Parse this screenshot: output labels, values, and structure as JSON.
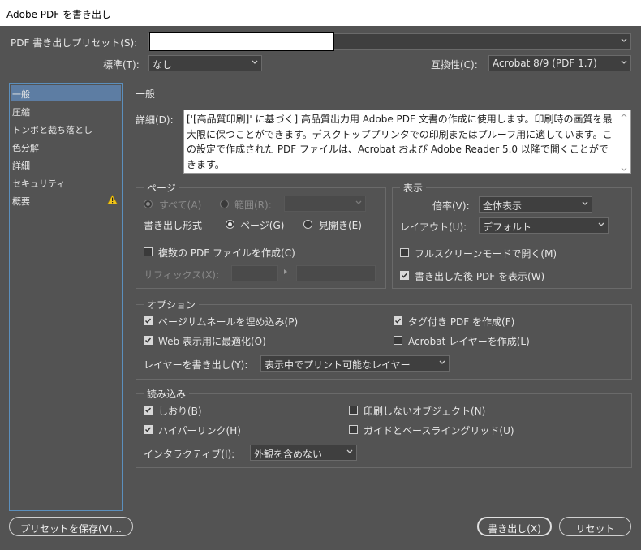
{
  "window": {
    "title": "Adobe PDF を書き出し"
  },
  "preset": {
    "label": "PDF 書き出しプリセット(S):"
  },
  "standard": {
    "label": "標準(T):",
    "value": "なし"
  },
  "compat": {
    "label": "互換性(C):",
    "value": "Acrobat 8/9 (PDF 1.7)"
  },
  "sidebar": {
    "items": [
      {
        "label": "一般"
      },
      {
        "label": "圧縮"
      },
      {
        "label": "トンボと裁ち落とし"
      },
      {
        "label": "色分解"
      },
      {
        "label": "詳細"
      },
      {
        "label": "セキュリティ"
      },
      {
        "label": "概要"
      }
    ],
    "selected_index": 0
  },
  "general": {
    "heading": "一般",
    "desc_label": "詳細(D):",
    "description": "['[高品質印刷]' に基づく] 高品質出力用 Adobe PDF 文書の作成に使用します。印刷時の画質を最大限に保つことができます。デスクトッププリンタでの印刷またはプルーフ用に適しています。この設定で作成された PDF ファイルは、Acrobat および Adobe Reader 5.0 以降で開くことができます。"
  },
  "pages": {
    "legend": "ページ",
    "all": "すべて(A)",
    "range": "範囲(R):",
    "export_as": "書き出し形式",
    "page": "ページ(G)",
    "spreads": "見開き(E)",
    "multi_pdf": "複数の PDF ファイルを作成(C)",
    "suffix": "サフィックス(X):"
  },
  "view": {
    "legend": "表示",
    "zoom_label": "倍率(V):",
    "zoom_value": "全体表示",
    "layout_label": "レイアウト(U):",
    "layout_value": "デフォルト",
    "fullscreen": "フルスクリーンモードで開く(M)",
    "view_after": "書き出した後 PDF を表示(W)"
  },
  "options": {
    "legend": "オプション",
    "thumbs": "ページサムネールを埋め込み(P)",
    "web": "Web 表示用に最適化(O)",
    "tagged": "タグ付き PDF を作成(F)",
    "acro_layers": "Acrobat レイヤーを作成(L)",
    "export_layers_label": "レイヤーを書き出し(Y):",
    "export_layers_value": "表示中でプリント可能なレイヤー"
  },
  "include": {
    "legend": "読み込み",
    "bookmarks": "しおり(B)",
    "hyperlinks": "ハイパーリンク(H)",
    "nonprint": "印刷しないオブジェクト(N)",
    "guides": "ガイドとベースライングリッド(U)",
    "interactive_label": "インタラクティブ(I):",
    "interactive_value": "外観を含めない"
  },
  "footer": {
    "save_preset": "プリセットを保存(V)...",
    "export": "書き出し(X)",
    "reset": "リセット"
  },
  "state": {
    "all_checked": true,
    "page_checked": true,
    "spreads_checked": false,
    "multi_pdf": false,
    "fullscreen": false,
    "view_after": true,
    "thumbs": true,
    "web": true,
    "tagged": true,
    "acro_layers": false,
    "bookmarks": true,
    "hyperlinks": true,
    "nonprint": false,
    "guides": false
  },
  "colors": {
    "bg": "#535353",
    "selection": "#5d7da3",
    "warning": "#f0c419"
  }
}
